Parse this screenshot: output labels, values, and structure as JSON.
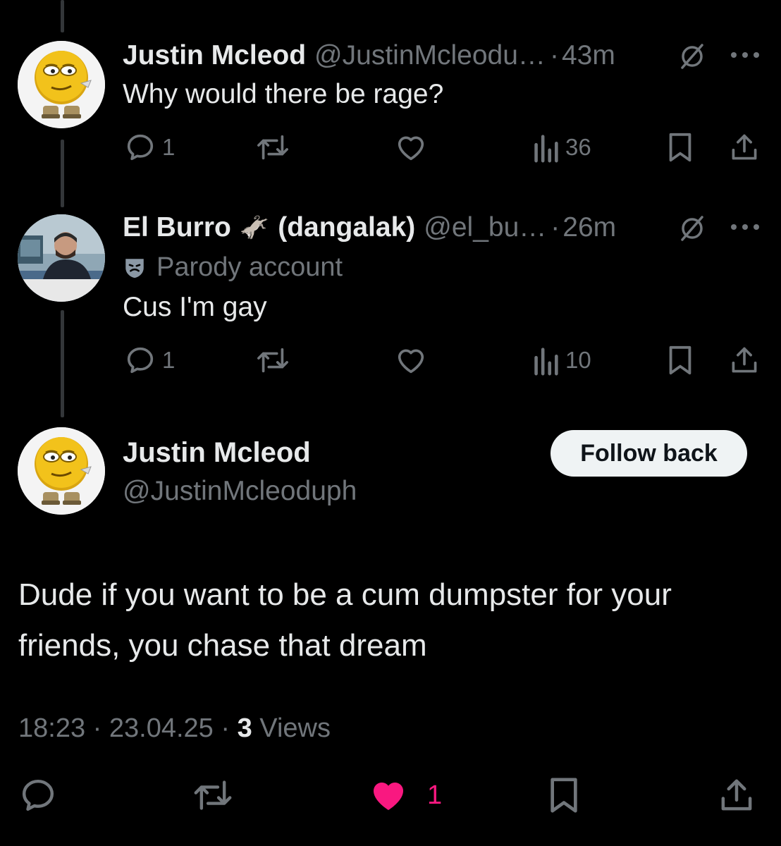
{
  "thread": [
    {
      "name": "Justin Mcleod",
      "handle": "@JustinMcleodu…",
      "time": "43m",
      "text": "Why would there be rage?",
      "replies": "1",
      "views": "36",
      "avatar_icon": "emoji-face-avatar"
    },
    {
      "name": "El Burro",
      "name_suffix": "(dangalak)",
      "name_emoji": "🫏",
      "handle": "@el_bu…",
      "time": "26m",
      "parody_label": "Parody account",
      "text": "Cus I'm gay",
      "replies": "1",
      "views": "10",
      "avatar_icon": "man-photo-avatar"
    }
  ],
  "main_post": {
    "name": "Justin Mcleod",
    "handle": "@JustinMcleoduph",
    "follow_label": "Follow back",
    "text": "Dude if you want to be a cum dumpster for your friends, you chase that dream",
    "time": "18:23",
    "date": "23.04.25",
    "views_count": "3",
    "views_label": "Views",
    "likes": "1"
  },
  "colors": {
    "background": "#000000",
    "text": "#e7e9ea",
    "muted": "#71767b",
    "like_active": "#f91880",
    "button_bg": "#eff3f4"
  }
}
